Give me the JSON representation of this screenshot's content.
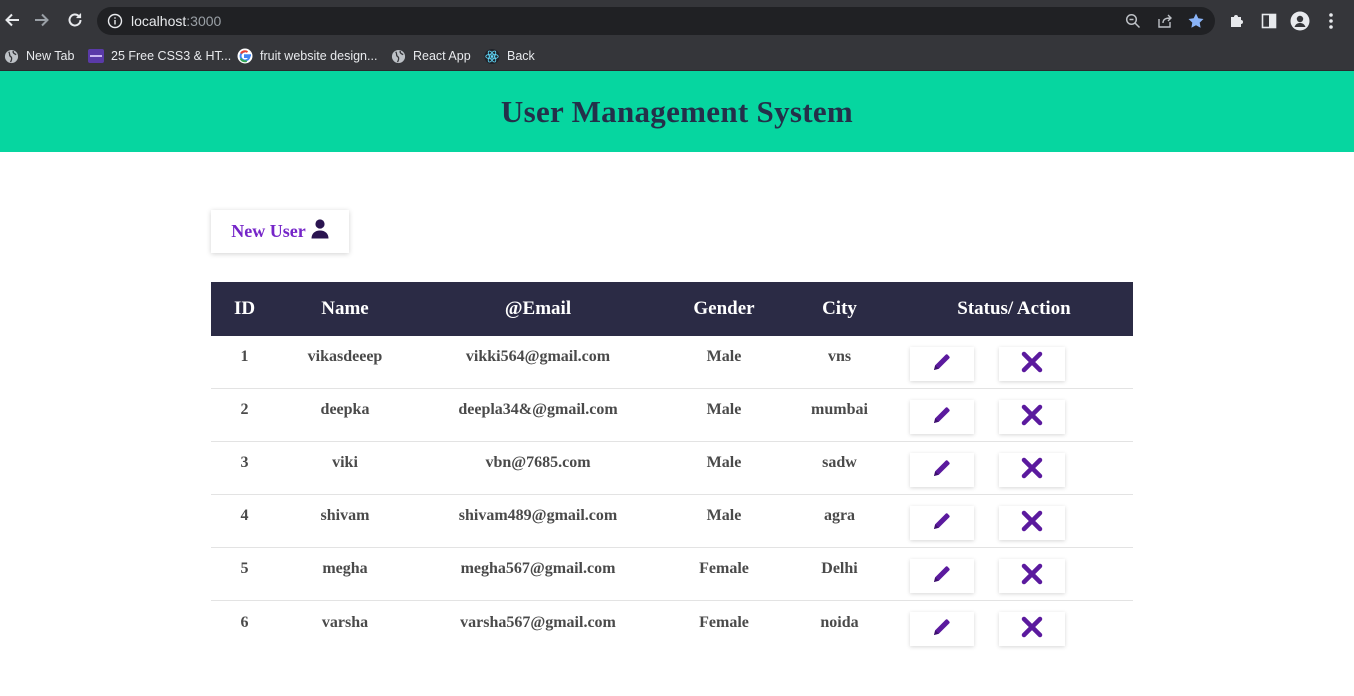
{
  "browser": {
    "url_host": "localhost",
    "url_port": ":3000",
    "bookmarks": [
      {
        "label": "New Tab",
        "icon": "globe-icon"
      },
      {
        "label": "25 Free CSS3 & HT...",
        "icon": "colorlib-icon"
      },
      {
        "label": "fruit website design...",
        "icon": "google-icon"
      },
      {
        "label": "React App",
        "icon": "globe-icon"
      },
      {
        "label": "Back",
        "icon": "react-icon"
      }
    ]
  },
  "page": {
    "title": "User Management System",
    "new_user_label": "New User"
  },
  "table": {
    "headers": {
      "id": "ID",
      "name": "Name",
      "email": "@Email",
      "gender": "Gender",
      "city": "City",
      "action": "Status/ Action"
    },
    "rows": [
      {
        "id": "1",
        "name": "vikasdeeep",
        "email": "vikki564@gmail.com",
        "gender": "Male",
        "city": "vns"
      },
      {
        "id": "2",
        "name": "deepka",
        "email": "deepla34&@gmail.com",
        "gender": "Male",
        "city": "mumbai"
      },
      {
        "id": "3",
        "name": "viki",
        "email": "vbn@7685.com",
        "gender": "Male",
        "city": "sadw"
      },
      {
        "id": "4",
        "name": "shivam",
        "email": "shivam489@gmail.com",
        "gender": "Male",
        "city": "agra"
      },
      {
        "id": "5",
        "name": "megha",
        "email": "megha567@gmail.com",
        "gender": "Female",
        "city": "Delhi"
      },
      {
        "id": "6",
        "name": "varsha",
        "email": "varsha567@gmail.com",
        "gender": "Female",
        "city": "noida"
      }
    ]
  },
  "colors": {
    "header_bg": "#06d6a0",
    "title_text": "#24304a",
    "table_head_bg": "#2b2b45",
    "accent_purple": "#5b1a9e"
  }
}
